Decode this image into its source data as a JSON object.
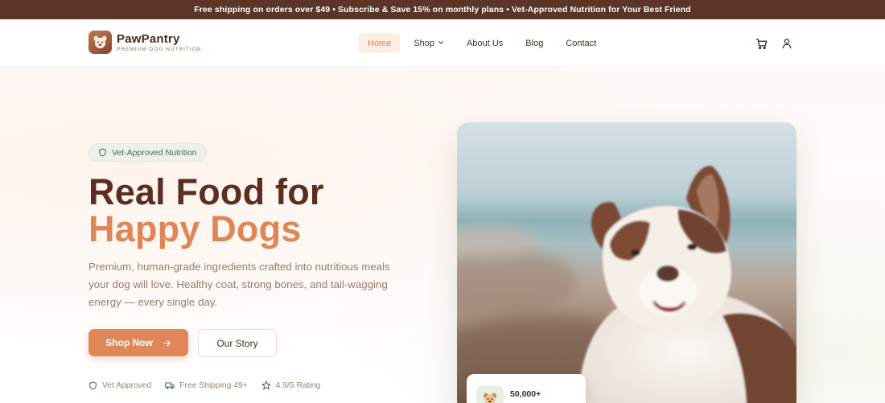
{
  "announcement": "Free shipping on orders over $49 • Subscribe & Save 15% on monthly plans • Vet-Approved Nutrition for Your Best Friend",
  "brand": {
    "name": "PawPantry",
    "tagline": "PREMIUM DOG NUTRITION",
    "icon": "dog-face-icon"
  },
  "nav": {
    "items": [
      {
        "label": "Home",
        "active": true
      },
      {
        "label": "Shop",
        "has_dropdown": true
      },
      {
        "label": "About Us"
      },
      {
        "label": "Blog"
      },
      {
        "label": "Contact"
      }
    ]
  },
  "header_icons": [
    "cart-icon",
    "user-icon"
  ],
  "hero": {
    "badge": "Vet-Approved Nutrition",
    "title_line1": "Real Food for",
    "title_line2": "Happy Dogs",
    "lead": "Premium, human-grade ingredients crafted into nutritious meals your dog will love. Healthy coat, strong bones, and tail-wagging energy — every single day.",
    "primary_cta": "Shop Now",
    "secondary_cta": "Our Story",
    "trust": [
      {
        "icon": "shield-icon",
        "label": "Vet Approved"
      },
      {
        "icon": "truck-icon",
        "label": "Free Shipping 49+"
      },
      {
        "icon": "star-icon",
        "label": "4.9/5 Rating"
      }
    ],
    "stat": {
      "value": "50,000+"
    }
  },
  "colors": {
    "announce_bg": "#5a3528",
    "accent": "#e0875a",
    "title_dark": "#5a2e22",
    "badge_green": "#4a6b50"
  }
}
